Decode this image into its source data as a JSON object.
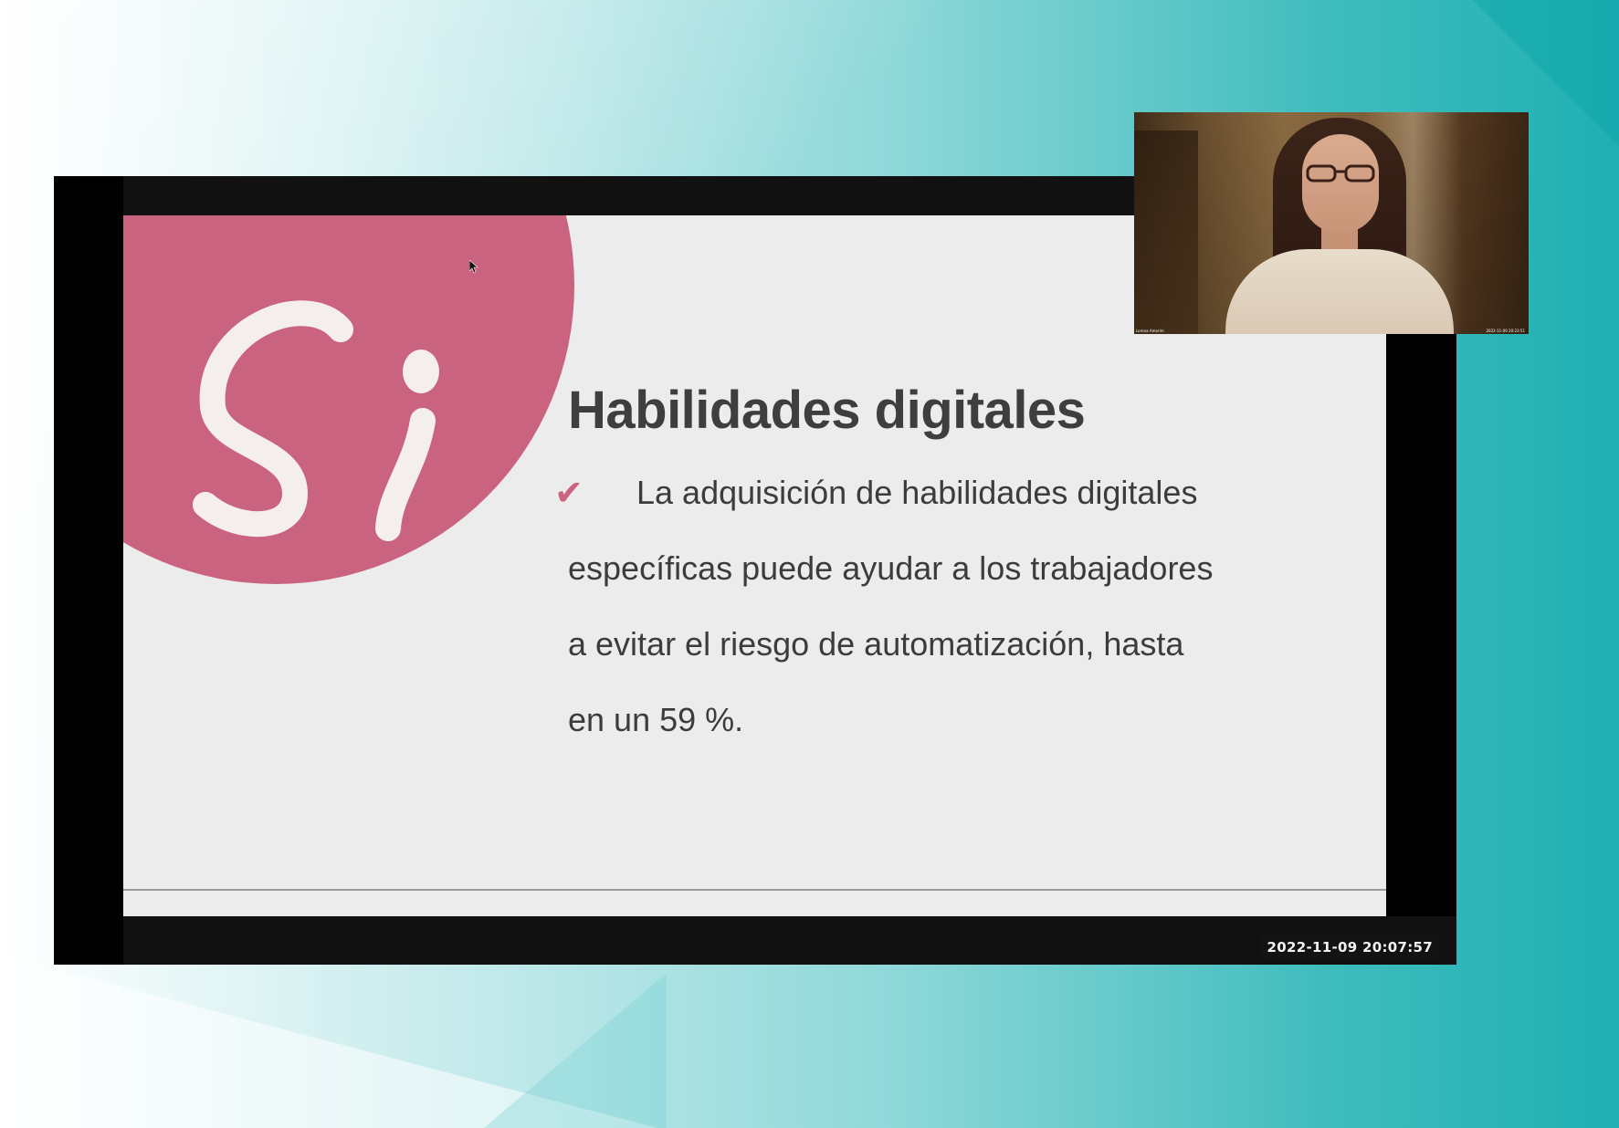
{
  "slide": {
    "title": "Habilidades digitales",
    "bullet_icon": "check-icon",
    "lines": [
      "La adquisición de habilidades digitales",
      "específicas puede ayudar a los trabajadores",
      "a evitar el riesgo de automatización, hasta",
      "en un 59 %."
    ],
    "logo_icon": "si-logo-icon",
    "accent_color": "#c9637f"
  },
  "screen_share": {
    "timestamp": "2022-11-09  20:07:57"
  },
  "camera": {
    "participant_name": "Lorena Amorim",
    "timestamp": "2022-11-09 20:23:51"
  },
  "colors": {
    "background_left": "#ffffff",
    "background_right": "#1fb0b2",
    "slide_background": "#ececec",
    "text": "#3e3e3e"
  }
}
